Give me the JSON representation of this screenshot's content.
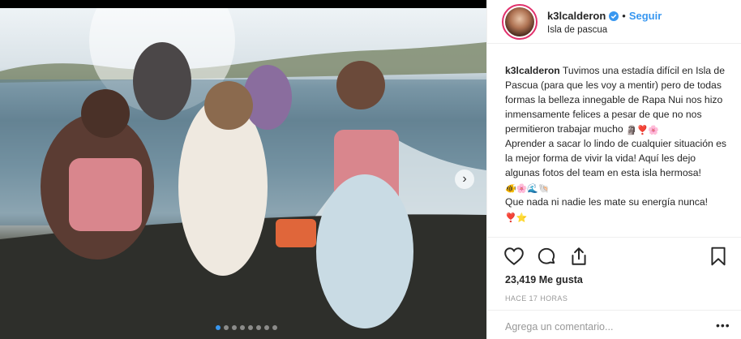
{
  "post": {
    "username": "k3lcalderon",
    "follow_label": "Seguir",
    "separator": "•",
    "location": "Isla de pascua",
    "caption": {
      "username": "k3lcalderon",
      "paragraph1": "Tuvimos una estadía difícil en Isla de Pascua (para que les voy a mentir) pero de todas formas la belleza innegable de Rapa Nui nos hizo inmensamente felices a pesar de que no nos permitieron trabajar mucho",
      "paragraph1_emoji": "🗿❣️🌸",
      "paragraph2": "Aprender a sacar lo lindo de cualquier situación es la mejor forma de vivir la vida! Aquí les dejo algunas fotos del team en esta isla hermosa!",
      "paragraph2_emoji": "🐠🌸🌊🐚",
      "paragraph3": "Que nada ni nadie les mate su energía nunca!",
      "paragraph3_emoji": "❣️⭐"
    },
    "likes": "23,419 Me gusta",
    "time": "HACE 17 HORAS",
    "comment_placeholder": "Agrega un comentario...",
    "more_label": "•••",
    "next_icon": "chevron-right-icon",
    "carousel": {
      "count": 8,
      "active": 0
    }
  },
  "colors": {
    "link": "#3897f0",
    "text": "#262626",
    "muted": "#999999",
    "border": "#efefef"
  }
}
